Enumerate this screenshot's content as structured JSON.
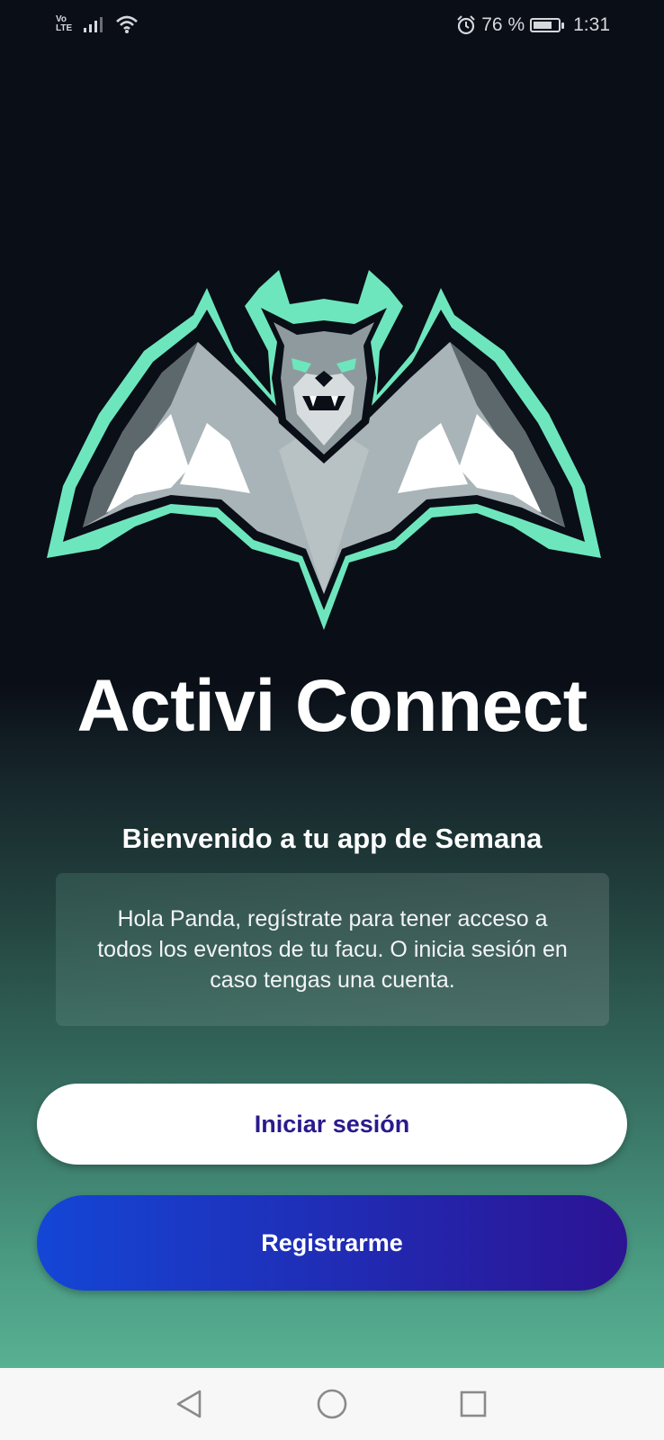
{
  "status_bar": {
    "network": "Vo LTE",
    "battery_text": "76 %",
    "battery_level": 0.76,
    "time": "1:31",
    "icons": [
      "volte-icon",
      "signal-icon",
      "wifi-icon",
      "alarm-icon",
      "battery-icon"
    ]
  },
  "app": {
    "title": "Activi Connect",
    "logo": "bat-logo",
    "welcome": "Bienvenido a tu app de Semana",
    "info": "Hola Panda, regístrate para tener acceso a todos los eventos de tu facu. O inicia sesión en caso tengas una cuenta."
  },
  "buttons": {
    "login_label": "Iniciar sesión",
    "register_label": "Registrarme"
  },
  "colors": {
    "background_top": "#0a0e17",
    "background_bottom": "#58b192",
    "logo_outline": "#6ee6bd",
    "login_text": "#2a1a8c",
    "register_gradient_start": "#1446d6",
    "register_gradient_end": "#2c1394"
  },
  "nav_bar": {
    "icons": [
      "back-icon",
      "home-icon",
      "recents-icon"
    ]
  }
}
